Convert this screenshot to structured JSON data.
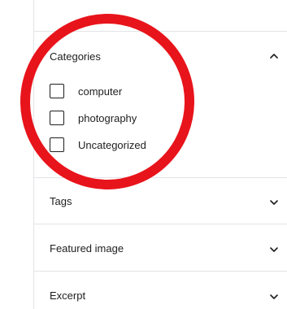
{
  "sidebar": {
    "categories_panel": {
      "title": "Categories",
      "expanded": true,
      "items": [
        {
          "label": "computer",
          "checked": false
        },
        {
          "label": "photography",
          "checked": false
        },
        {
          "label": "Uncategorized",
          "checked": false
        }
      ]
    },
    "tags_panel": {
      "title": "Tags",
      "expanded": false
    },
    "featured_image_panel": {
      "title": "Featured image",
      "expanded": false
    },
    "excerpt_panel": {
      "title": "Excerpt",
      "expanded": false
    }
  },
  "icons": {
    "collapse": "chevron-up-icon",
    "expand": "chevron-down-icon"
  },
  "annotation": {
    "shape": "ellipse",
    "color": "#e8141b"
  }
}
